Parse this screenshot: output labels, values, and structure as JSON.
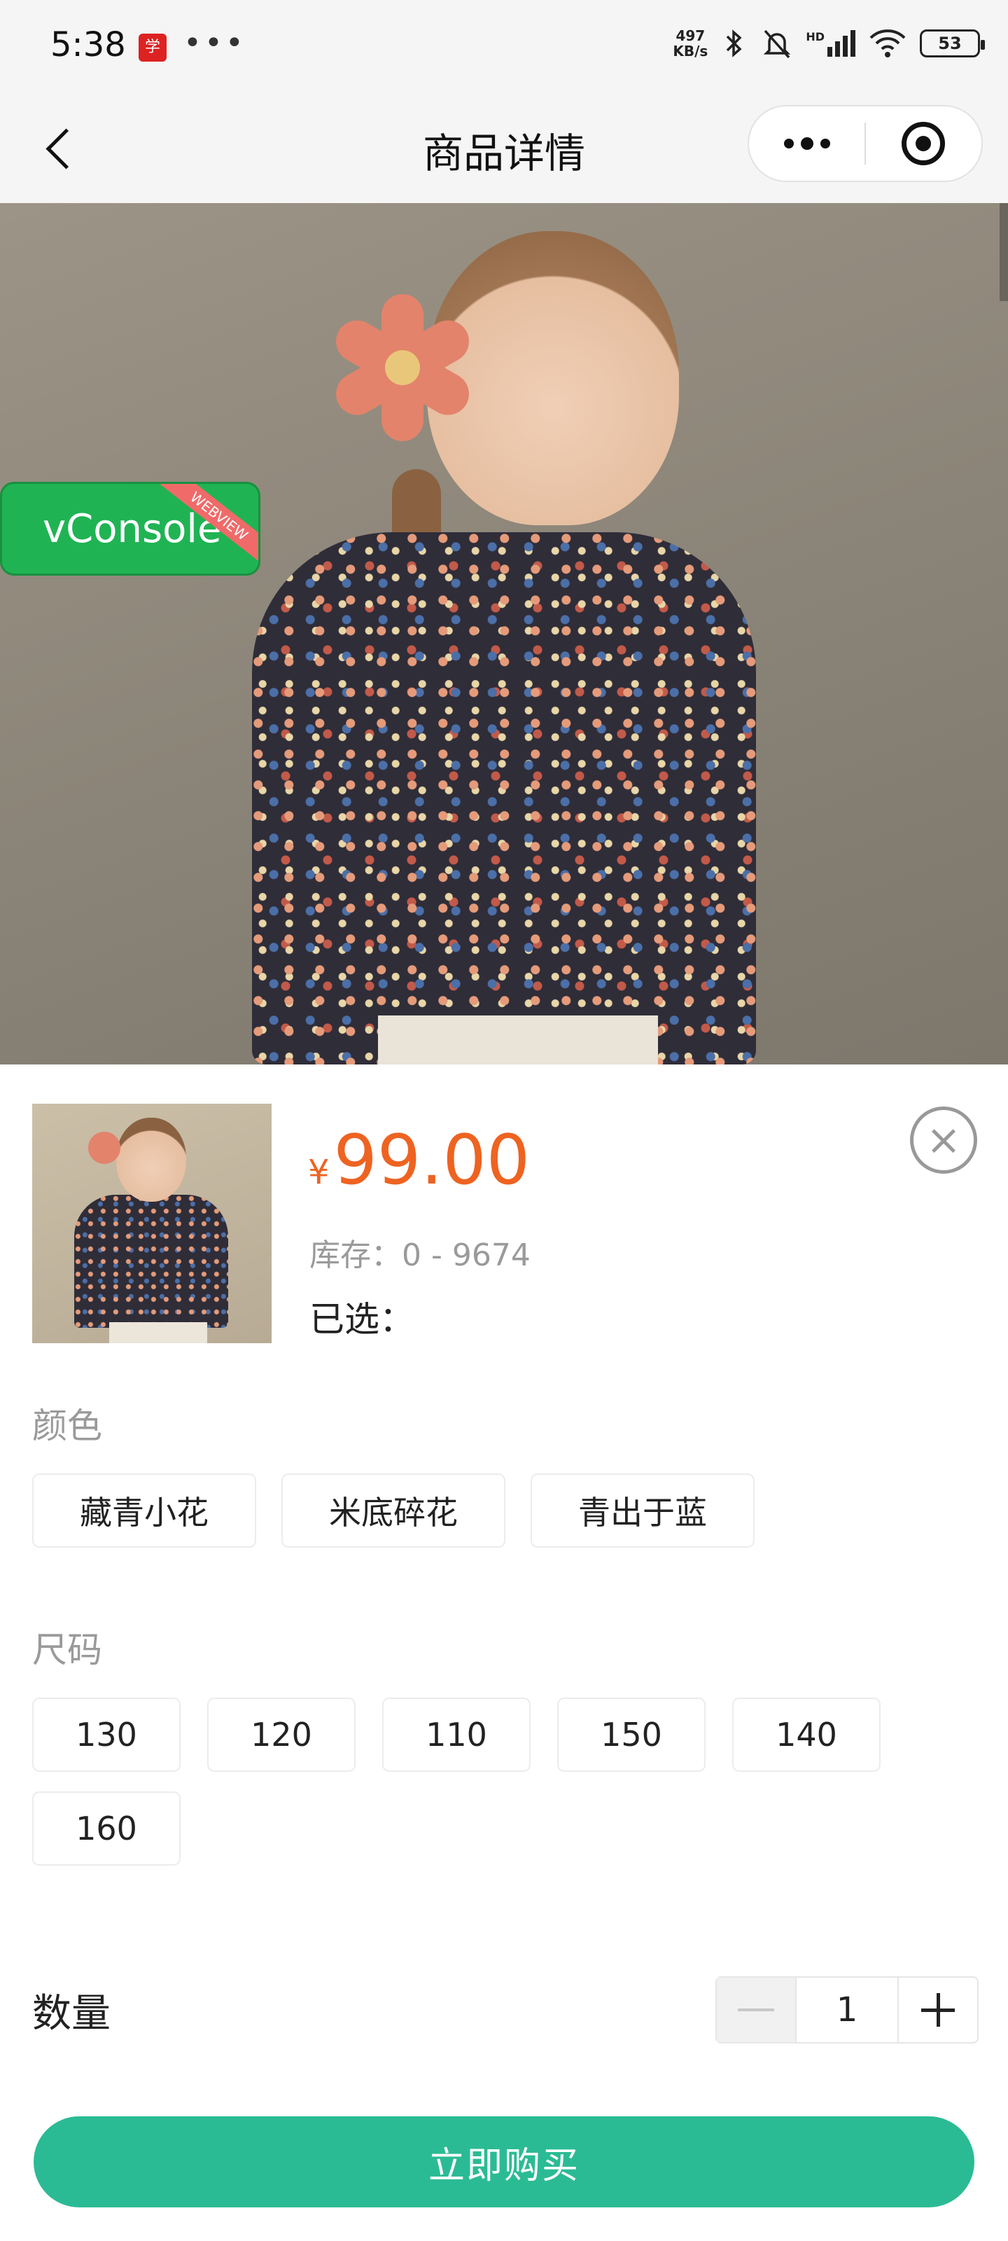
{
  "status_bar": {
    "time": "5:38",
    "app_icon_text": "学",
    "more": "•••",
    "net_speed_value": "497",
    "net_speed_unit": "KB/s",
    "signal_label": "HD",
    "battery": "53"
  },
  "nav": {
    "title": "商品详情"
  },
  "vconsole": {
    "label": "vConsole",
    "ribbon": "WEBVIEW"
  },
  "product": {
    "currency": "¥",
    "price": "99.00",
    "stock": "库存：0 - 9674",
    "selected": "已选："
  },
  "color": {
    "label": "颜色",
    "options": [
      "藏青小花",
      "米底碎花",
      "青出于蓝"
    ]
  },
  "size": {
    "label": "尺码",
    "options": [
      "130",
      "120",
      "110",
      "150",
      "140",
      "160"
    ]
  },
  "quantity": {
    "label": "数量",
    "value": "1"
  },
  "buy_button": "立即购买",
  "colors": {
    "price": "#ee6321",
    "buy_button": "#2bbb94",
    "vconsole": "#20b354"
  },
  "icons": {
    "back": "back-arrow-icon",
    "more": "more-dots-icon",
    "close_app": "target-icon",
    "close_sheet": "close-icon",
    "minus": "minus-icon",
    "plus": "plus-icon"
  }
}
